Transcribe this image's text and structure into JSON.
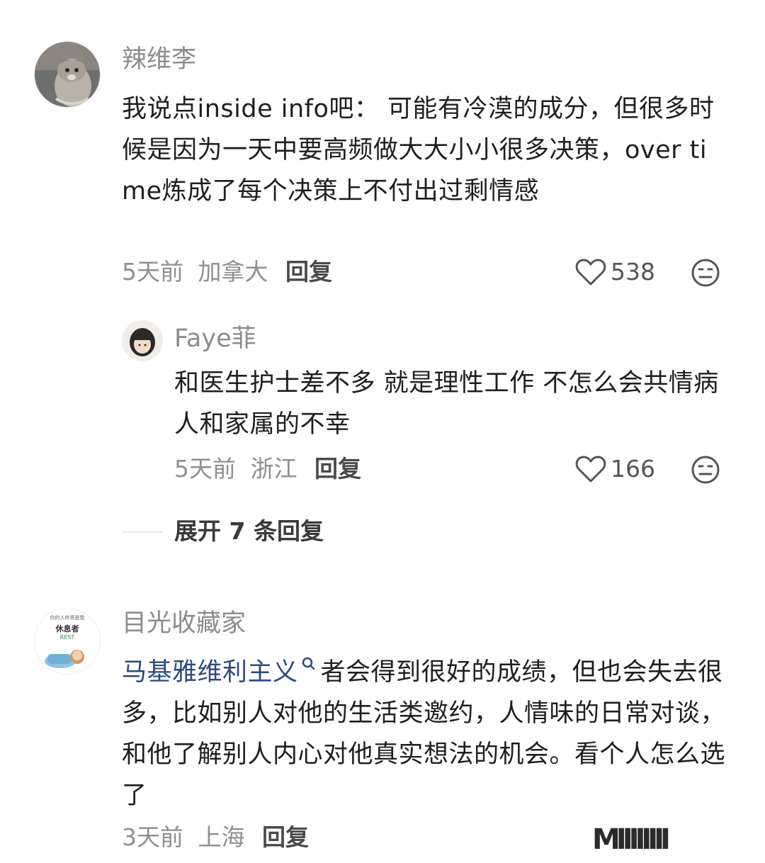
{
  "comments": [
    {
      "username": "辣维李",
      "text": "我说点inside info吧： 可能有冷漠的成分，但很多时候是因为一天中要高频做大大小小很多决策，over time炼成了每个决策上不付出过剩情感",
      "time": "5天前",
      "location": "加拿大",
      "reply_label": "回复",
      "likes": "538",
      "replies": [
        {
          "username": "Faye菲",
          "text": "和医生护士差不多 就是理性工作 不怎么会共情病人和家属的不幸",
          "time": "5天前",
          "location": "浙江",
          "reply_label": "回复",
          "likes": "166"
        }
      ],
      "expand_label": "展开 7 条回复"
    },
    {
      "username": "目光收藏家",
      "avatar_text": {
        "line1": "你的人终将是我",
        "line2": "休息者",
        "line3": "REST"
      },
      "mention": "马基雅维利主义",
      "text": "者会得到很好的成绩，但也会失去很多，比如别人对他的生活类邀约，人情味的日常对谈，和他了解别人内心对他真实想法的机会。看个人怎么选了",
      "time": "3天前",
      "location": "上海",
      "reply_label": "回复"
    }
  ],
  "watermark": "MIIIIIIII",
  "colors": {
    "username": "#8c8c8c",
    "meta": "#8f8f8f",
    "mention": "#2c4a7c",
    "text": "#1f1f1f"
  },
  "icons": [
    "heart-icon",
    "dislike-face-icon",
    "search-link-icon"
  ]
}
